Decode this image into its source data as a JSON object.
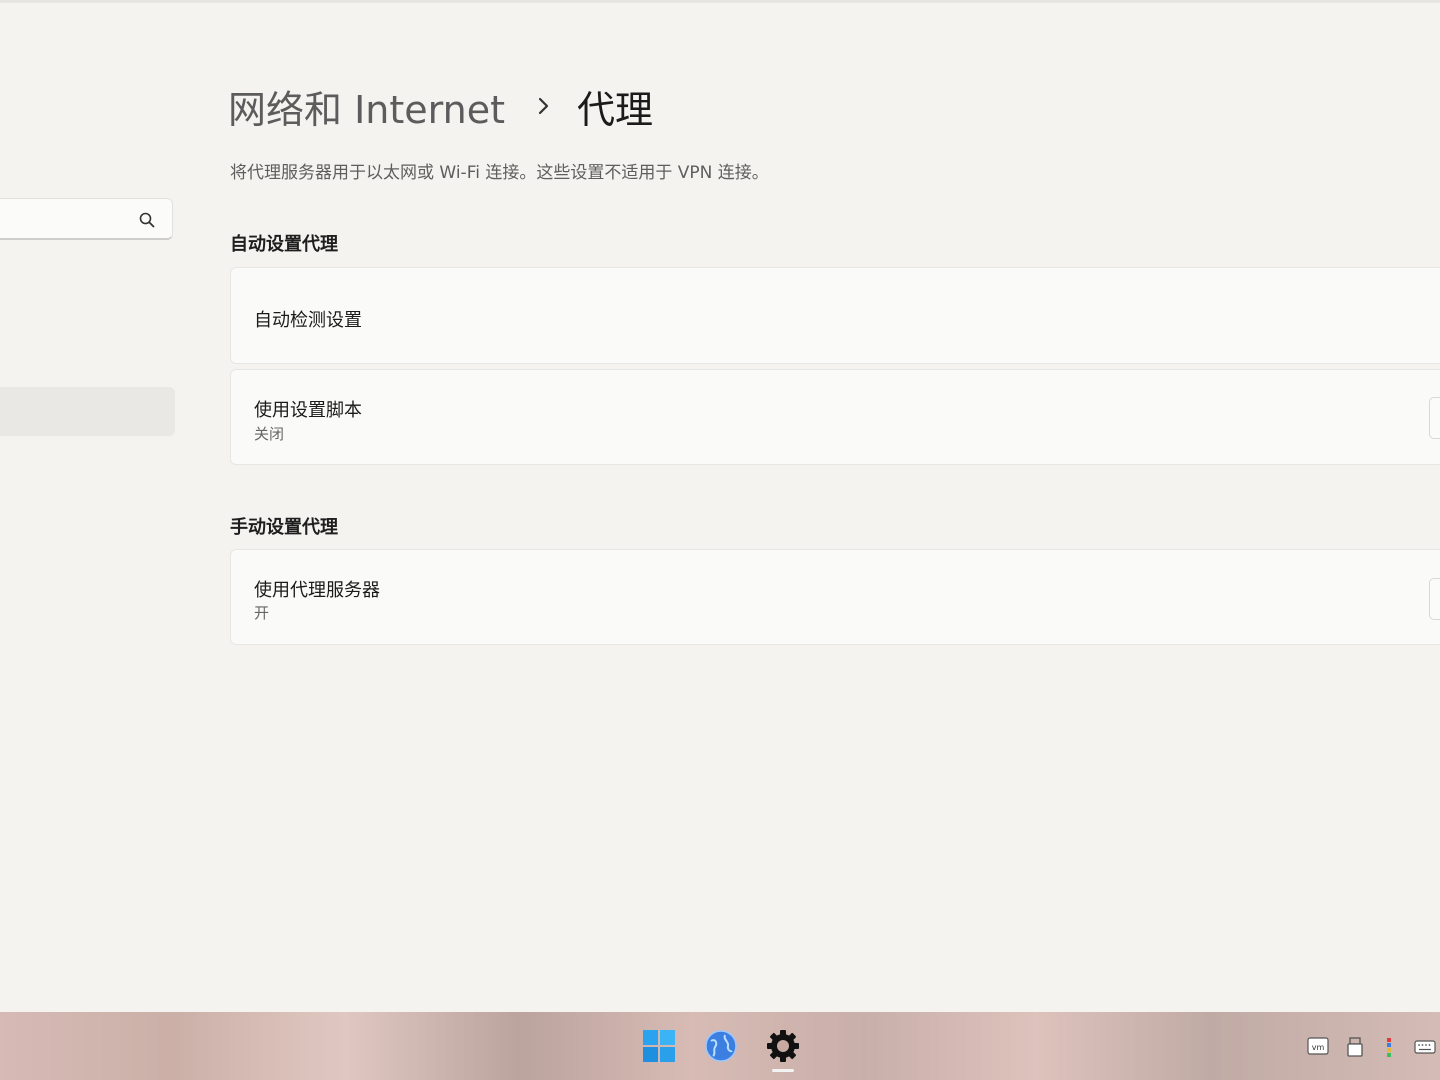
{
  "search": {
    "value": "",
    "placeholder": ""
  },
  "header": {
    "parent": "网络和 Internet",
    "current": "代理",
    "description": "将代理服务器用于以太网或 Wi-Fi 连接。这些设置不适用于 VPN 连接。"
  },
  "auto_section": {
    "title": "自动设置代理",
    "detect_settings": {
      "label": "自动检测设置"
    },
    "setup_script": {
      "label": "使用设置脚本",
      "status": "关闭"
    }
  },
  "manual_section": {
    "title": "手动设置代理",
    "proxy_server": {
      "label": "使用代理服务器",
      "status": "开"
    }
  },
  "taskbar": {
    "apps": [
      {
        "icon": "windows-start-icon"
      },
      {
        "icon": "browser-globe-icon"
      },
      {
        "icon": "settings-gear-icon",
        "active": true
      }
    ],
    "tray": [
      {
        "icon": "vmware-icon",
        "text": "vm"
      },
      {
        "icon": "usb-drive-icon"
      },
      {
        "icon": "color-picker-icon"
      },
      {
        "icon": "keyboard-icon"
      }
    ]
  }
}
